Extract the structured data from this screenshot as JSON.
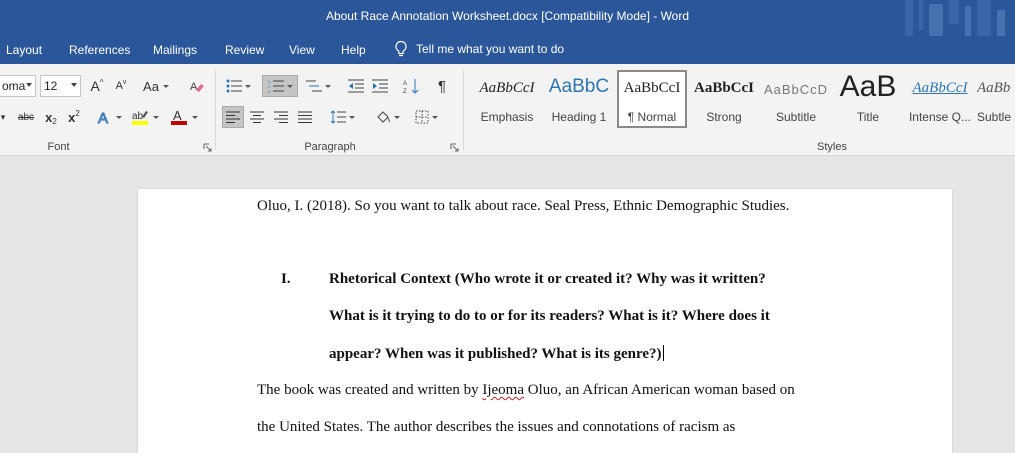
{
  "window": {
    "title": "About Race Annotation Worksheet.docx [Compatibility Mode]  -  Word"
  },
  "tabs": [
    {
      "label": "Layout"
    },
    {
      "label": "References"
    },
    {
      "label": "Mailings"
    },
    {
      "label": "Review"
    },
    {
      "label": "View"
    },
    {
      "label": "Help"
    }
  ],
  "tell_me": {
    "label": "Tell me what you want to do",
    "icon": "lightbulb-icon"
  },
  "ribbon": {
    "font": {
      "group_label": "Font",
      "font_name": "oma",
      "font_size": "12",
      "change_case": "Aa",
      "grow_glyph": "A",
      "shrink_glyph": "A",
      "strike_glyph": "abc",
      "subscript_glyph": "x",
      "superscript_glyph": "x",
      "font_color": "#c00000",
      "highlight_color": "#ffff00"
    },
    "paragraph": {
      "group_label": "Paragraph",
      "pilcrow": "¶"
    },
    "styles": {
      "group_label": "Styles",
      "items": [
        {
          "sample": "AaBbCcI",
          "name": "Emphasis"
        },
        {
          "sample": "AaBbC",
          "name": "Heading 1"
        },
        {
          "sample": "AaBbCcI",
          "name": "¶ Normal",
          "selected": true
        },
        {
          "sample": "AaBbCcI",
          "name": "Strong"
        },
        {
          "sample": "AaBbCcD",
          "name": "Subtitle"
        },
        {
          "sample": "AaB",
          "name": "Title"
        },
        {
          "sample": "AaBbCcI",
          "name": "Intense Q..."
        },
        {
          "sample": "AaBb",
          "name": "Subtle"
        }
      ]
    }
  },
  "document": {
    "citation": "Oluo, I. (2018). So you want to talk about race. Seal Press, Ethnic Demographic Studies.",
    "numeral": "I.",
    "heading_lines": [
      "Rhetorical Context (Who wrote it or created it? Why was it written?",
      "What is it trying to do to or for its readers? What is it? Where does it",
      "appear? When was it published? What is its genre?)"
    ],
    "body_line1_pre": "The book was created and written by ",
    "body_line1_misspelled": "Ijeoma",
    "body_line1_post": " Oluo, an African American woman based on",
    "body_line2": "the United States. The author describes the issues and connotations of racism as"
  },
  "colors": {
    "titlebar": "#2b579a",
    "ribbon": "#f3f3f3",
    "canvas": "#e6e6e6"
  }
}
